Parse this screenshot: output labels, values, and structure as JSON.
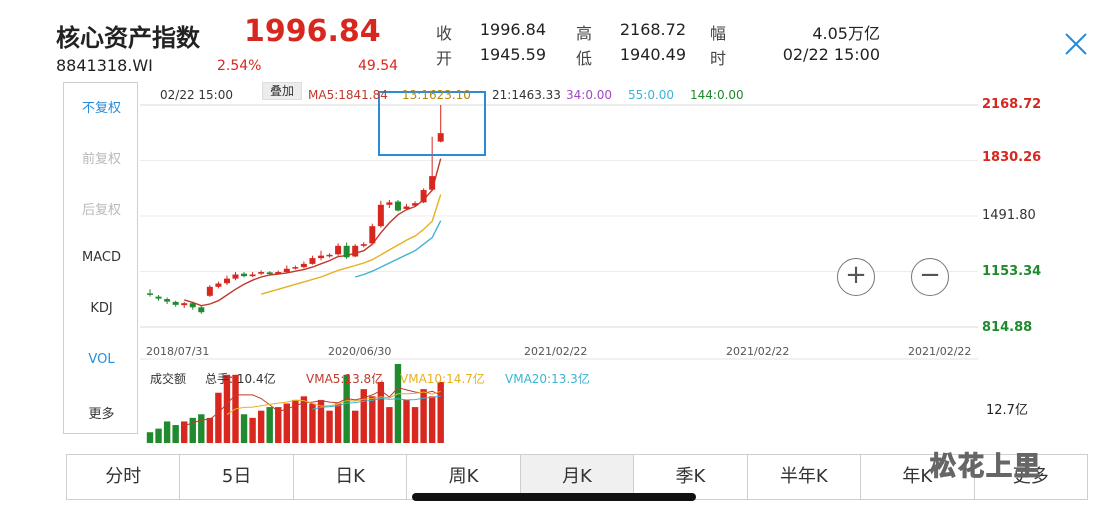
{
  "header": {
    "title": "核心资产指数",
    "price": "1996.84",
    "code": "8841318.WI",
    "change_pct": "2.54%",
    "change_value": "49.54",
    "stats": [
      {
        "label": "收",
        "value": "1996.84"
      },
      {
        "label": "高",
        "value": "2168.72"
      },
      {
        "label": "幅",
        "value": "4.05万亿"
      },
      {
        "label": "开",
        "value": "1945.59"
      },
      {
        "label": "低",
        "value": "1940.49"
      },
      {
        "label": "时",
        "value": "02/22 15:00"
      }
    ]
  },
  "left_panel": {
    "items": [
      "不复权",
      "前复权",
      "后复权",
      "MACD",
      "KDJ",
      "VOL",
      "更多"
    ],
    "active_index": 0,
    "active_secondary_index": 5
  },
  "overlay_button": "叠加",
  "legend": {
    "date": "02/22 15:00",
    "ma5": "MA5:1841.84",
    "ma13": "13:1623.10",
    "ma21": "21:1463.33",
    "ma34": "34:0.00",
    "ma55": "55:0.00",
    "ma144": "144:0.00"
  },
  "colors": {
    "up": "#d7271f",
    "down": "#1f8a2e",
    "ma5": "#c0392b",
    "ma13": "#e6b021",
    "ma21": "#3db3d6",
    "highlight": "#2a8cd8"
  },
  "chart_data": {
    "type": "candlestick",
    "y_labels": [
      "2168.72",
      "1830.26",
      "1491.80",
      "1153.34",
      "814.88"
    ],
    "ylim": [
      814.88,
      2168.72
    ],
    "x_labels": [
      "2018/07/31",
      "2020/06/30",
      "2021/02/22",
      "2021/02/22",
      "2021/02/22"
    ],
    "candles": [
      {
        "o": 1020,
        "c": 1016,
        "h": 1045,
        "l": 1000
      },
      {
        "o": 1000,
        "c": 988,
        "h": 1010,
        "l": 975
      },
      {
        "o": 985,
        "c": 970,
        "h": 995,
        "l": 955
      },
      {
        "o": 968,
        "c": 950,
        "h": 975,
        "l": 938
      },
      {
        "o": 948,
        "c": 960,
        "h": 968,
        "l": 930
      },
      {
        "o": 960,
        "c": 935,
        "h": 965,
        "l": 920
      },
      {
        "o": 935,
        "c": 905,
        "h": 945,
        "l": 895
      },
      {
        "o": 1005,
        "c": 1060,
        "h": 1070,
        "l": 998
      },
      {
        "o": 1060,
        "c": 1080,
        "h": 1092,
        "l": 1050
      },
      {
        "o": 1082,
        "c": 1110,
        "h": 1128,
        "l": 1070
      },
      {
        "o": 1110,
        "c": 1135,
        "h": 1150,
        "l": 1100
      },
      {
        "o": 1140,
        "c": 1125,
        "h": 1150,
        "l": 1118
      },
      {
        "o": 1125,
        "c": 1135,
        "h": 1150,
        "l": 1120
      },
      {
        "o": 1140,
        "c": 1150,
        "h": 1160,
        "l": 1132
      },
      {
        "o": 1148,
        "c": 1138,
        "h": 1155,
        "l": 1130
      },
      {
        "o": 1140,
        "c": 1150,
        "h": 1160,
        "l": 1135
      },
      {
        "o": 1150,
        "c": 1170,
        "h": 1190,
        "l": 1145
      },
      {
        "o": 1175,
        "c": 1180,
        "h": 1190,
        "l": 1165
      },
      {
        "o": 1180,
        "c": 1200,
        "h": 1215,
        "l": 1172
      },
      {
        "o": 1200,
        "c": 1235,
        "h": 1250,
        "l": 1195
      },
      {
        "o": 1235,
        "c": 1250,
        "h": 1280,
        "l": 1222
      },
      {
        "o": 1250,
        "c": 1255,
        "h": 1265,
        "l": 1238
      },
      {
        "o": 1258,
        "c": 1310,
        "h": 1325,
        "l": 1250
      },
      {
        "o": 1310,
        "c": 1240,
        "h": 1330,
        "l": 1230
      },
      {
        "o": 1245,
        "c": 1310,
        "h": 1320,
        "l": 1240
      },
      {
        "o": 1310,
        "c": 1320,
        "h": 1332,
        "l": 1300
      },
      {
        "o": 1325,
        "c": 1430,
        "h": 1445,
        "l": 1318
      },
      {
        "o": 1430,
        "c": 1560,
        "h": 1585,
        "l": 1420
      },
      {
        "o": 1560,
        "c": 1575,
        "h": 1590,
        "l": 1540
      },
      {
        "o": 1580,
        "c": 1525,
        "h": 1590,
        "l": 1520
      },
      {
        "o": 1535,
        "c": 1550,
        "h": 1565,
        "l": 1528
      },
      {
        "o": 1555,
        "c": 1570,
        "h": 1582,
        "l": 1548
      },
      {
        "o": 1575,
        "c": 1650,
        "h": 1660,
        "l": 1570
      },
      {
        "o": 1652,
        "c": 1735,
        "h": 1975,
        "l": 1645
      },
      {
        "o": 1945.59,
        "c": 1996.84,
        "h": 2168.72,
        "l": 1940.49
      }
    ],
    "ma5": [
      null,
      null,
      null,
      null,
      980,
      965,
      945,
      955,
      975,
      1010,
      1045,
      1075,
      1100,
      1120,
      1132,
      1138,
      1145,
      1155,
      1165,
      1180,
      1200,
      1220,
      1245,
      1250,
      1265,
      1280,
      1320,
      1390,
      1450,
      1500,
      1530,
      1550,
      1590,
      1650,
      1841.84
    ],
    "ma13": [
      null,
      null,
      null,
      null,
      null,
      null,
      null,
      null,
      null,
      null,
      null,
      null,
      null,
      1015,
      1030,
      1045,
      1060,
      1075,
      1090,
      1105,
      1120,
      1140,
      1160,
      1175,
      1190,
      1205,
      1225,
      1255,
      1285,
      1315,
      1345,
      1370,
      1410,
      1460,
      1623.1
    ],
    "ma21": [
      null,
      null,
      null,
      null,
      null,
      null,
      null,
      null,
      null,
      null,
      null,
      null,
      null,
      null,
      null,
      null,
      null,
      null,
      null,
      null,
      null,
      null,
      null,
      null,
      1120,
      1135,
      1155,
      1180,
      1205,
      1230,
      1255,
      1280,
      1320,
      1360,
      1463.33
    ],
    "vol_legend": {
      "title": "成交额",
      "total": "总手: 10.4亿",
      "vma5": "VMA5:13.8亿",
      "vma10": "VMA10:14.7亿",
      "vma20": "VMA20:13.3亿",
      "ymax": "12.7亿"
    },
    "volume": [
      3,
      4,
      6,
      5,
      6,
      7,
      8,
      7,
      14,
      19,
      19,
      8,
      7,
      9,
      10,
      10,
      11,
      12,
      13,
      11,
      12,
      9,
      11,
      19,
      9,
      15,
      13,
      17,
      10,
      22,
      12,
      10,
      15,
      13,
      17
    ]
  },
  "controls": {
    "zoom_in": "+",
    "zoom_out": "−"
  },
  "tabs": [
    "分时",
    "5日",
    "日K",
    "周K",
    "月K",
    "季K",
    "半年K",
    "年K",
    "更多"
  ],
  "selected_tab": 4,
  "watermark": "松花上里"
}
